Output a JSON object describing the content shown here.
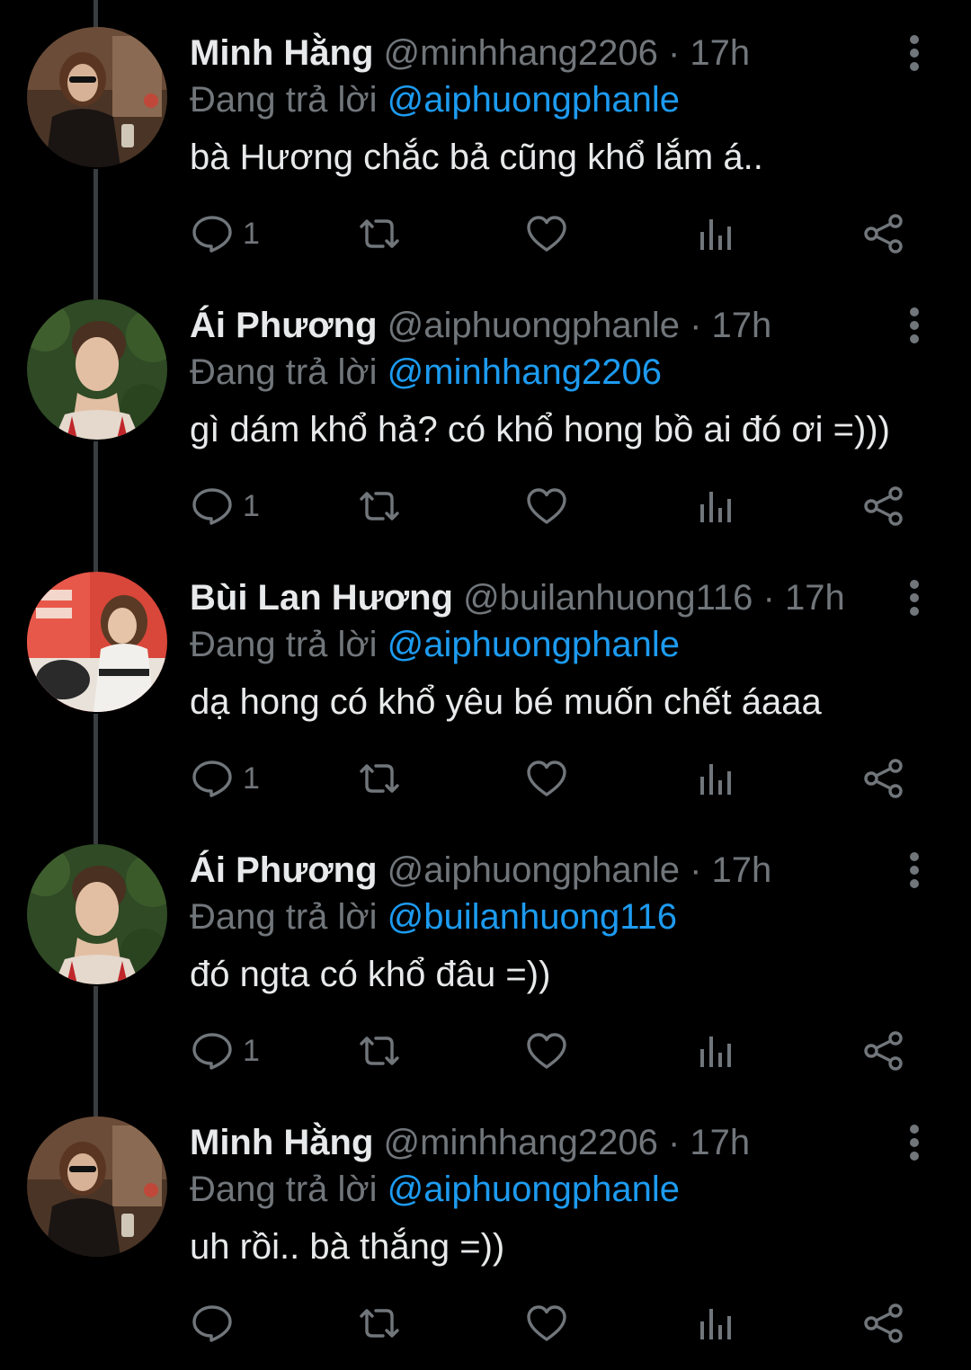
{
  "tweets": [
    {
      "avatar": "minh-hang-avatar",
      "display_name": "Minh Hằng",
      "handle": "@minhhang2206",
      "dot": "·",
      "time": "17h",
      "reply_prefix": "Đang trả lời",
      "reply_to": "@aiphuongphanle",
      "text": "bà Hương chắc bả cũng khổ lắm á..",
      "reply_count": "1"
    },
    {
      "avatar": "ai-phuong-avatar",
      "display_name": "Ái Phương",
      "handle": "@aiphuongphanle",
      "dot": "·",
      "time": "17h",
      "reply_prefix": "Đang trả lời",
      "reply_to": "@minhhang2206",
      "text": "gì dám khổ hả? có khổ hong bồ ai đó ơi =)))",
      "reply_count": "1"
    },
    {
      "avatar": "bui-lan-huong-avatar",
      "display_name": "Bùi Lan Hương",
      "handle": "@builanhuong116",
      "dot": "·",
      "time": "17h",
      "reply_prefix": "Đang trả lời",
      "reply_to": "@aiphuongphanle",
      "text": "dạ hong có khổ yêu bé muốn chết áaaa",
      "reply_count": "1"
    },
    {
      "avatar": "ai-phuong-avatar",
      "display_name": "Ái Phương",
      "handle": "@aiphuongphanle",
      "dot": "·",
      "time": "17h",
      "reply_prefix": "Đang trả lời",
      "reply_to": "@builanhuong116",
      "text": "đó ngta có khổ đâu =))",
      "reply_count": "1"
    },
    {
      "avatar": "minh-hang-avatar",
      "display_name": "Minh Hằng",
      "handle": "@minhhang2206",
      "dot": "·",
      "time": "17h",
      "reply_prefix": "Đang trả lời",
      "reply_to": "@aiphuongphanle",
      "text": "uh rồi.. bà thắng =))",
      "reply_count": ""
    }
  ],
  "icons": {
    "reply": "reply-icon",
    "retweet": "retweet-icon",
    "like": "heart-icon",
    "views": "views-icon",
    "share": "share-icon",
    "more": "more-vertical-icon"
  },
  "colors": {
    "background": "#000000",
    "text_primary": "#e7e9ea",
    "text_secondary": "#71767b",
    "mention": "#1d9bf0",
    "thread_line": "#3a3d40"
  }
}
